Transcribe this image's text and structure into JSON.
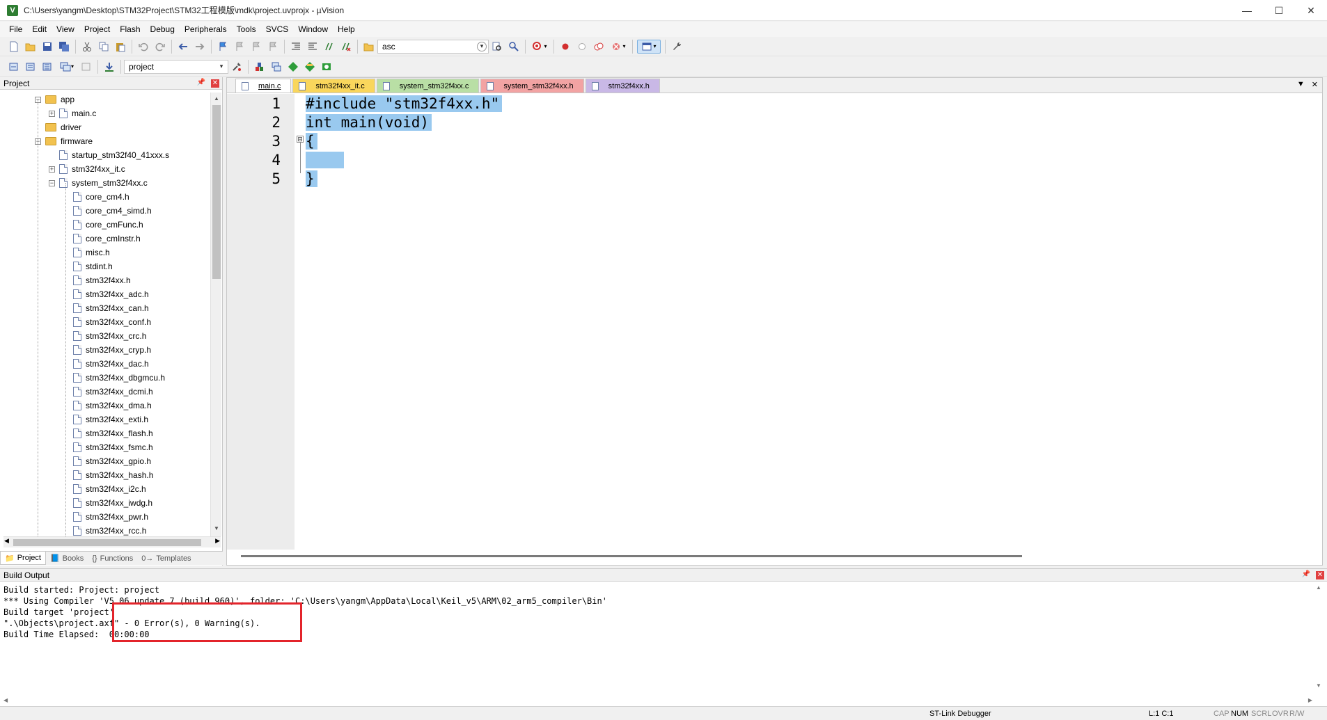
{
  "window": {
    "title": "C:\\Users\\yangm\\Desktop\\STM32Project\\STM32工程模版\\mdk\\project.uvprojx - µVision",
    "app_icon_letter": "V",
    "controls": [
      "—",
      "☐",
      "✕"
    ]
  },
  "menu": [
    "File",
    "Edit",
    "View",
    "Project",
    "Flash",
    "Debug",
    "Peripherals",
    "Tools",
    "SVCS",
    "Window",
    "Help"
  ],
  "toolbar": {
    "find_value": "asc",
    "target_value": "project"
  },
  "project_panel": {
    "title": "Project",
    "tree": [
      {
        "label": "app",
        "type": "folder",
        "level": 0,
        "expanded": true
      },
      {
        "label": "main.c",
        "type": "file",
        "level": 1,
        "expandable": true
      },
      {
        "label": "driver",
        "type": "folder",
        "level": 0
      },
      {
        "label": "firmware",
        "type": "folder",
        "level": 0,
        "expanded": true
      },
      {
        "label": "startup_stm32f40_41xxx.s",
        "type": "file",
        "level": 1
      },
      {
        "label": "stm32f4xx_it.c",
        "type": "file",
        "level": 1,
        "expandable": true
      },
      {
        "label": "system_stm32f4xx.c",
        "type": "file",
        "level": 1,
        "expanded": true
      },
      {
        "label": "core_cm4.h",
        "type": "file",
        "level": 2
      },
      {
        "label": "core_cm4_simd.h",
        "type": "file",
        "level": 2
      },
      {
        "label": "core_cmFunc.h",
        "type": "file",
        "level": 2
      },
      {
        "label": "core_cmInstr.h",
        "type": "file",
        "level": 2
      },
      {
        "label": "misc.h",
        "type": "file",
        "level": 2
      },
      {
        "label": "stdint.h",
        "type": "file",
        "level": 2
      },
      {
        "label": "stm32f4xx.h",
        "type": "file",
        "level": 2
      },
      {
        "label": "stm32f4xx_adc.h",
        "type": "file",
        "level": 2
      },
      {
        "label": "stm32f4xx_can.h",
        "type": "file",
        "level": 2
      },
      {
        "label": "stm32f4xx_conf.h",
        "type": "file",
        "level": 2
      },
      {
        "label": "stm32f4xx_crc.h",
        "type": "file",
        "level": 2
      },
      {
        "label": "stm32f4xx_cryp.h",
        "type": "file",
        "level": 2
      },
      {
        "label": "stm32f4xx_dac.h",
        "type": "file",
        "level": 2
      },
      {
        "label": "stm32f4xx_dbgmcu.h",
        "type": "file",
        "level": 2
      },
      {
        "label": "stm32f4xx_dcmi.h",
        "type": "file",
        "level": 2
      },
      {
        "label": "stm32f4xx_dma.h",
        "type": "file",
        "level": 2
      },
      {
        "label": "stm32f4xx_exti.h",
        "type": "file",
        "level": 2
      },
      {
        "label": "stm32f4xx_flash.h",
        "type": "file",
        "level": 2
      },
      {
        "label": "stm32f4xx_fsmc.h",
        "type": "file",
        "level": 2
      },
      {
        "label": "stm32f4xx_gpio.h",
        "type": "file",
        "level": 2
      },
      {
        "label": "stm32f4xx_hash.h",
        "type": "file",
        "level": 2
      },
      {
        "label": "stm32f4xx_i2c.h",
        "type": "file",
        "level": 2
      },
      {
        "label": "stm32f4xx_iwdg.h",
        "type": "file",
        "level": 2
      },
      {
        "label": "stm32f4xx_pwr.h",
        "type": "file",
        "level": 2
      },
      {
        "label": "stm32f4xx_rcc.h",
        "type": "file",
        "level": 2
      }
    ],
    "tabs": [
      {
        "label": "Project",
        "icon": "📁",
        "active": true
      },
      {
        "label": "Books",
        "icon": "📘"
      },
      {
        "label": "Functions",
        "icon": "{}"
      },
      {
        "label": "Templates",
        "icon": "0→"
      }
    ]
  },
  "editor": {
    "tabs": [
      {
        "label": "main.c",
        "color": "#ffffff",
        "active": true
      },
      {
        "label": "stm32f4xx_it.c",
        "color": "#f9d65c"
      },
      {
        "label": "system_stm32f4xx.c",
        "color": "#b9dfa5"
      },
      {
        "label": "system_stm32f4xx.h",
        "color": "#f2a3a3"
      },
      {
        "label": "stm32f4xx.h",
        "color": "#c9b8e6"
      }
    ],
    "lines": [
      {
        "n": "1",
        "text": "#include \"stm32f4xx.h\""
      },
      {
        "n": "2",
        "text": "int main(void)"
      },
      {
        "n": "3",
        "text": "{"
      },
      {
        "n": "4",
        "text": "    "
      },
      {
        "n": "5",
        "text": "}"
      }
    ],
    "fold_symbol": "⊟"
  },
  "build_output": {
    "title": "Build Output",
    "lines": [
      "Build started: Project: project",
      "*** Using Compiler 'V5.06 update 7 (build 960)', folder: 'C:\\Users\\yangm\\AppData\\Local\\Keil_v5\\ARM\\02_arm5_compiler\\Bin'",
      "Build target 'project'",
      "\".\\Objects\\project.axf\" - 0 Error(s), 0 Warning(s).",
      "Build Time Elapsed:  00:00:00"
    ],
    "highlight_color": "#e3242b"
  },
  "statusbar": {
    "debugger": "ST-Link Debugger",
    "position": "L:1 C:1",
    "indicators": [
      "CAP",
      "NUM",
      "SCRL",
      "OVR",
      "R/W"
    ]
  }
}
